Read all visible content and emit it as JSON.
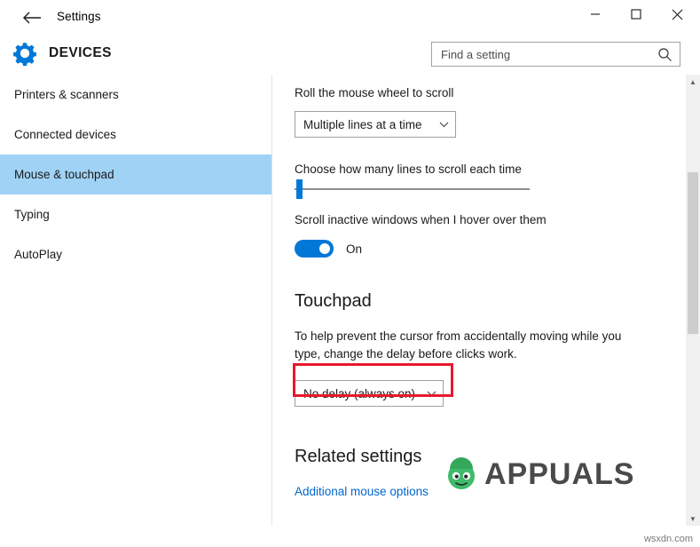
{
  "window": {
    "title": "Settings",
    "back_icon": "back-arrow-icon",
    "minimize_label": "─",
    "maximize_label": "□",
    "close_label": "✕"
  },
  "header": {
    "page_title": "DEVICES",
    "gear_icon": "gear-icon",
    "search": {
      "placeholder": "Find a setting",
      "value": "",
      "icon": "search-icon"
    }
  },
  "nav": {
    "items": [
      {
        "label": "Printers & scanners",
        "selected": false
      },
      {
        "label": "Connected devices",
        "selected": false
      },
      {
        "label": "Mouse & touchpad",
        "selected": true
      },
      {
        "label": "Typing",
        "selected": false
      },
      {
        "label": "AutoPlay",
        "selected": false
      }
    ]
  },
  "main": {
    "wheel_label": "Roll the mouse wheel to scroll",
    "wheel_dropdown": {
      "value": "Multiple lines at a time",
      "chevron": "∨"
    },
    "lines_label": "Choose how many lines to scroll each time",
    "lines_slider": {
      "position_percent": 2
    },
    "inactive_label": "Scroll inactive windows when I hover over them",
    "inactive_toggle": {
      "state_label": "On",
      "checked": true
    },
    "touchpad_heading": "Touchpad",
    "touchpad_description": "To help prevent the cursor from accidentally moving while you type, change the delay before clicks work.",
    "delay_dropdown": {
      "value": "No delay (always on)",
      "chevron": "∨"
    },
    "related_heading": "Related settings",
    "related_link": "Additional mouse options"
  },
  "annotation": {
    "highlight_color": "#e8192c",
    "target": "delay-dropdown"
  },
  "scrollbar": {
    "up_arrow": "▲",
    "down_arrow": "▼"
  },
  "watermark": {
    "brand": "APPUALS",
    "source": "wsxdn.com"
  },
  "colors": {
    "accent": "#0078d7",
    "selection": "#9fd2f5",
    "link": "#0066cc",
    "highlight": "#e8192c"
  }
}
